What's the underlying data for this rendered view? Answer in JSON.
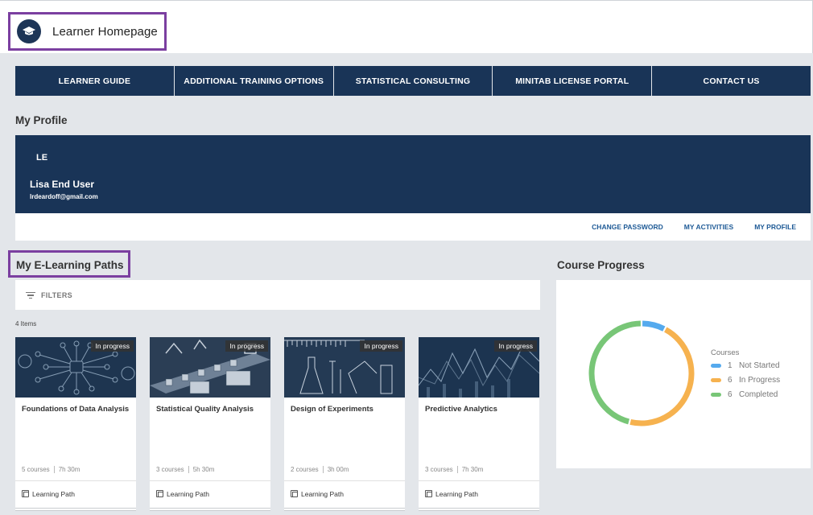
{
  "header": {
    "title": "Learner Homepage",
    "logo_icon": "graduation-cap-icon"
  },
  "nav": [
    {
      "label": "LEARNER GUIDE"
    },
    {
      "label": "ADDITIONAL TRAINING OPTIONS"
    },
    {
      "label": "STATISTICAL CONSULTING"
    },
    {
      "label": "MINITAB LICENSE PORTAL"
    },
    {
      "label": "CONTACT US"
    }
  ],
  "profile": {
    "section_title": "My Profile",
    "initials": "LE",
    "name": "Lisa End User",
    "email": "lrdeardoff@gmail.com",
    "links": [
      "CHANGE PASSWORD",
      "MY ACTIVITIES",
      "MY PROFILE"
    ]
  },
  "paths": {
    "section_title": "My E-Learning Paths",
    "filters_label": "FILTERS",
    "item_count": "4 Items",
    "cards": [
      {
        "title": "Foundations of Data Analysis",
        "status": "In progress",
        "courses": "5 courses",
        "duration": "7h 30m",
        "type": "Learning Path"
      },
      {
        "title": "Statistical Quality Analysis",
        "status": "In progress",
        "courses": "3 courses",
        "duration": "5h 30m",
        "type": "Learning Path"
      },
      {
        "title": "Design of Experiments",
        "status": "In progress",
        "courses": "2 courses",
        "duration": "3h 00m",
        "type": "Learning Path"
      },
      {
        "title": "Predictive Analytics",
        "status": "In progress",
        "courses": "3 courses",
        "duration": "7h 30m",
        "type": "Learning Path"
      }
    ]
  },
  "course_progress": {
    "section_title": "Course Progress",
    "legend_title": "Courses",
    "items": [
      {
        "count": 1,
        "label": "Not Started",
        "color": "#55aaee"
      },
      {
        "count": 6,
        "label": "In Progress",
        "color": "#f6b24f"
      },
      {
        "count": 6,
        "label": "Completed",
        "color": "#78c677"
      }
    ]
  },
  "colors": {
    "navy": "#193457",
    "accent_purple": "#7b3fa0",
    "link_blue": "#1e5a96"
  }
}
